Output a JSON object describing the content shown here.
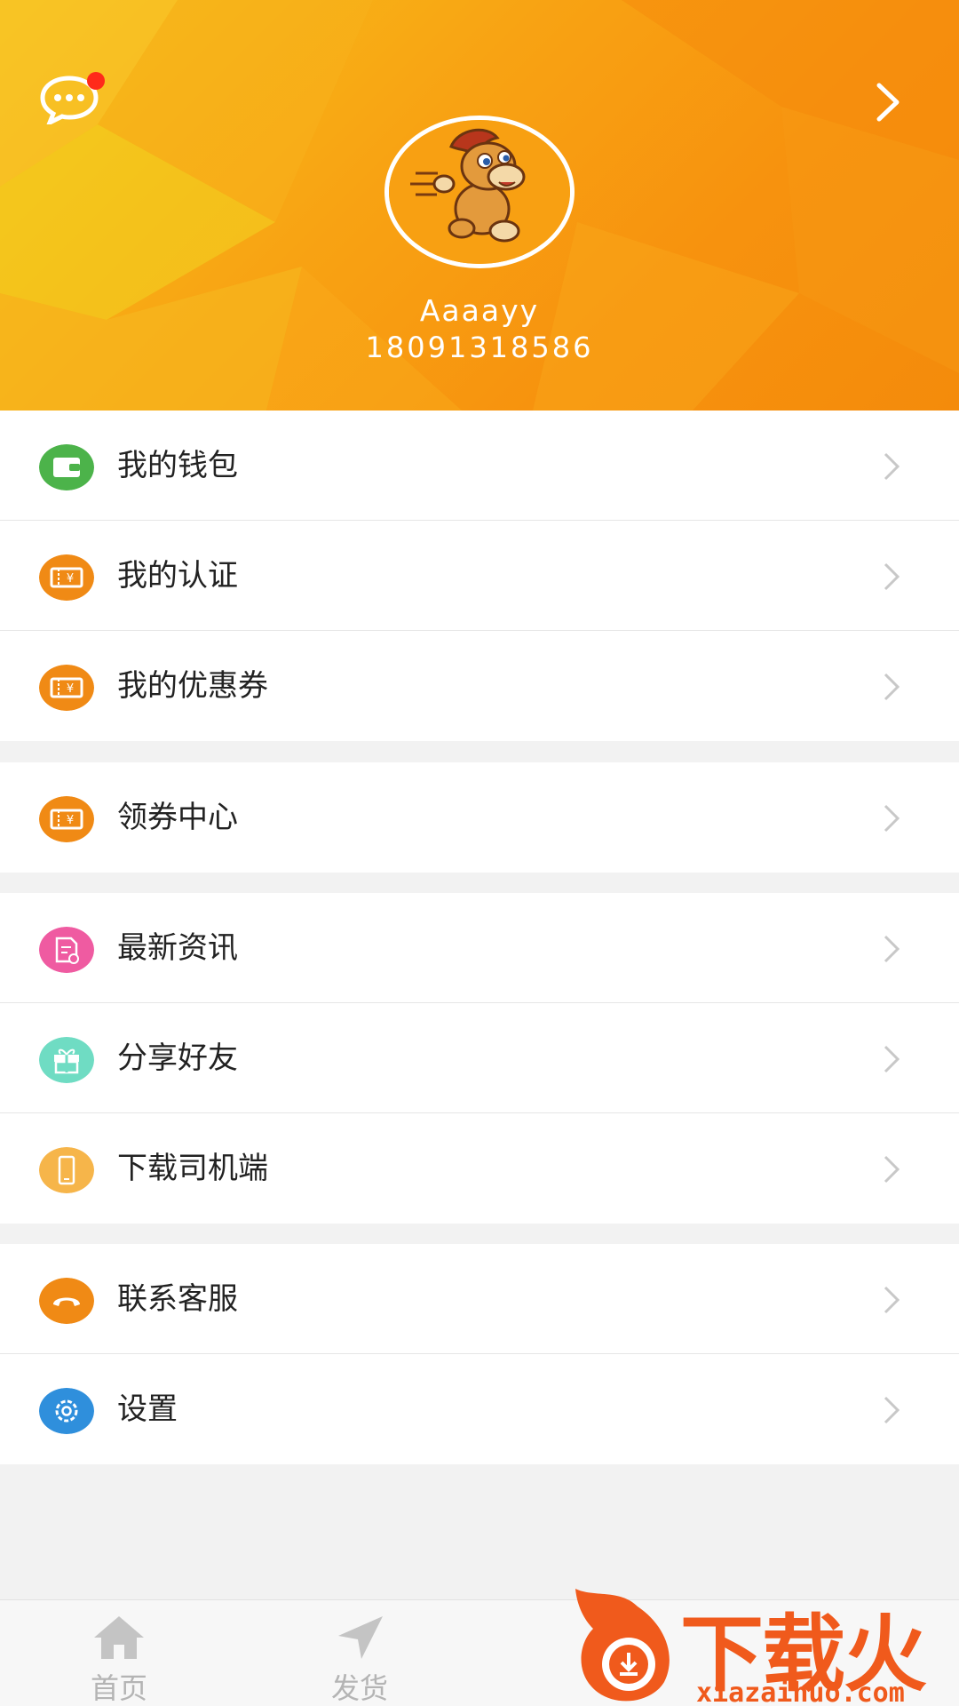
{
  "profile": {
    "username": "Aaaayy",
    "phone": "18091318586",
    "has_unread": true
  },
  "menu_groups": [
    [
      {
        "label": "我的钱包",
        "icon": "wallet-icon",
        "color": "#4cb34a"
      },
      {
        "label": "我的认证",
        "icon": "ticket-icon",
        "color": "#f08a15"
      },
      {
        "label": "我的优惠券",
        "icon": "ticket-icon",
        "color": "#f08a15"
      }
    ],
    [
      {
        "label": "领券中心",
        "icon": "ticket-icon",
        "color": "#f08a15"
      }
    ],
    [
      {
        "label": "最新资讯",
        "icon": "news-icon",
        "color": "#ef5ba1"
      },
      {
        "label": "分享好友",
        "icon": "gift-icon",
        "color": "#6fdcc3"
      },
      {
        "label": "下载司机端",
        "icon": "phone-icon",
        "color": "#f6b54a"
      }
    ],
    [
      {
        "label": "联系客服",
        "icon": "handset-icon",
        "color": "#f08a15"
      },
      {
        "label": "设置",
        "icon": "gear-icon",
        "color": "#2f8fdc"
      }
    ]
  ],
  "tabs": [
    {
      "label": "首页",
      "icon": "home-icon"
    },
    {
      "label": "发货",
      "icon": "send-icon"
    }
  ],
  "watermark": {
    "text": "下载火",
    "url": "xiazaihuo.com"
  },
  "colors": {
    "header_orange": "#f7920e",
    "tab_inactive": "#b4b4b4",
    "watermark": "#f05a1c"
  }
}
